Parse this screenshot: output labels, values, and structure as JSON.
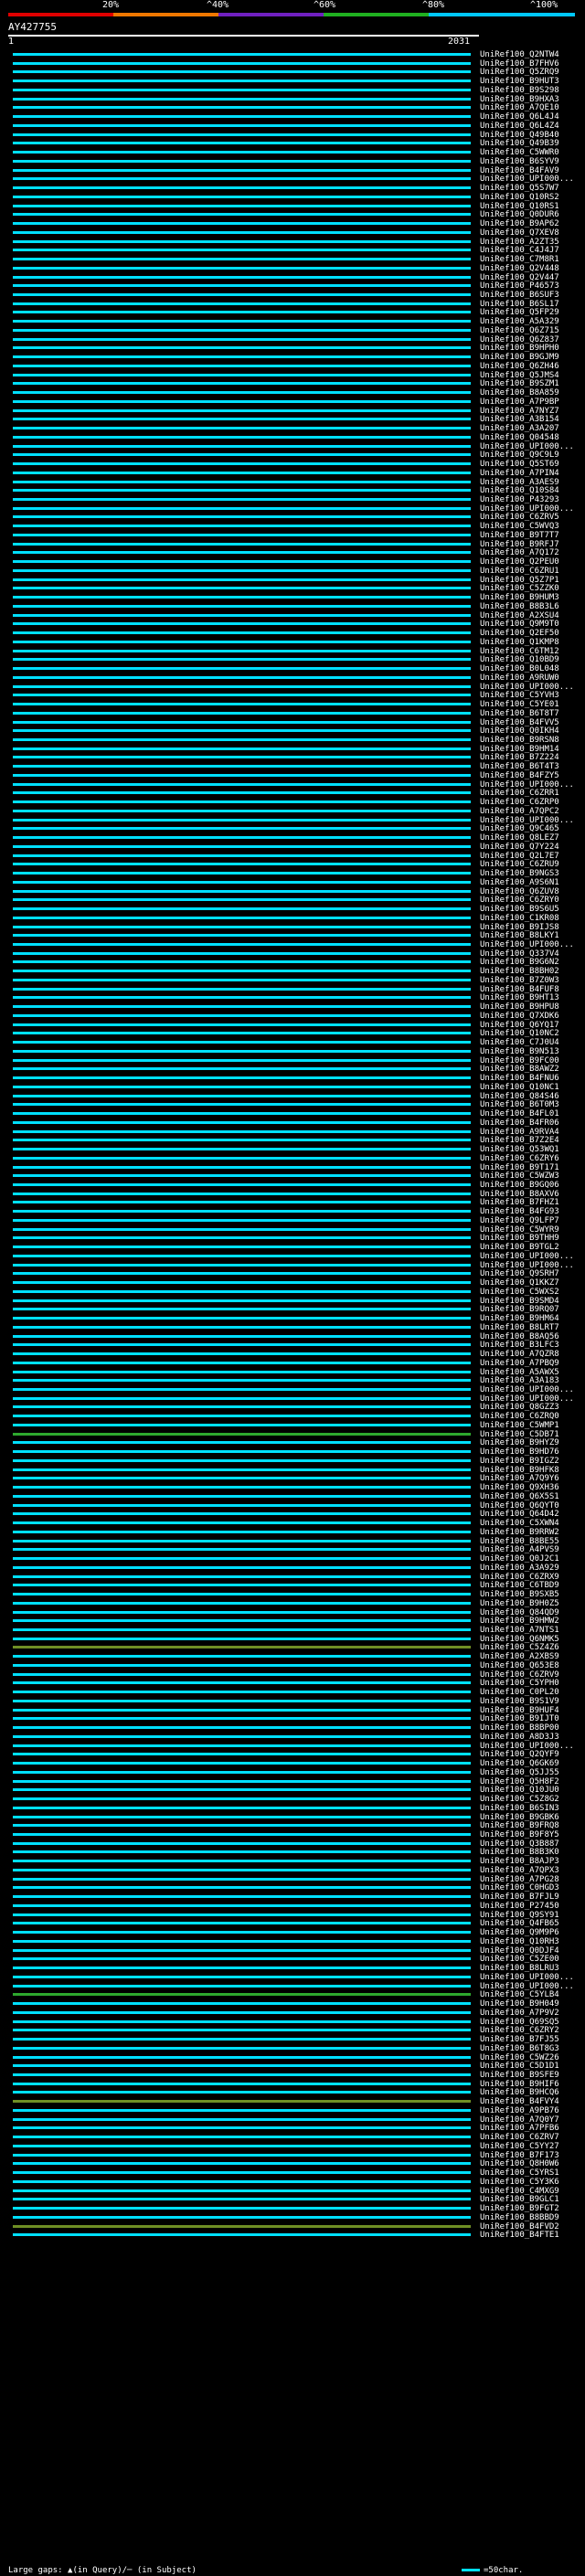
{
  "legend": {
    "colors": [
      "#e00000",
      "#f07800",
      "#7020c0",
      "#20b020",
      "#00c8ff"
    ],
    "ticks": [
      "20%",
      "^40%",
      "^60%",
      "^80%",
      "^100%"
    ]
  },
  "query": {
    "id": "AY427755",
    "start": "1",
    "end": "2031"
  },
  "hits": [
    {
      "label": "UniRef100_Q2NTW4",
      "color": "cyan"
    },
    {
      "label": "UniRef100_B7FHV6",
      "color": "cyan"
    },
    {
      "label": "UniRef100_Q5ZRQ9",
      "color": "cyan"
    },
    {
      "label": "UniRef100_B9HUT3",
      "color": "cyan"
    },
    {
      "label": "UniRef100_B9S298",
      "color": "cyan"
    },
    {
      "label": "UniRef100_B9HXA3",
      "color": "cyan"
    },
    {
      "label": "UniRef100_A7QE10",
      "color": "cyan"
    },
    {
      "label": "UniRef100_Q6L4J4",
      "color": "cyan"
    },
    {
      "label": "UniRef100_Q6L4Z4",
      "color": "cyan"
    },
    {
      "label": "UniRef100_Q49B40",
      "color": "cyan"
    },
    {
      "label": "UniRef100_Q49B39",
      "color": "cyan"
    },
    {
      "label": "UniRef100_C5WWR0",
      "color": "cyan"
    },
    {
      "label": "UniRef100_B6SYV9",
      "color": "cyan"
    },
    {
      "label": "UniRef100_B4FAV9",
      "color": "cyan"
    },
    {
      "label": "UniRef100_UPI000...",
      "color": "cyan"
    },
    {
      "label": "UniRef100_Q5S7W7",
      "color": "cyan"
    },
    {
      "label": "UniRef100_Q10RS2",
      "color": "cyan"
    },
    {
      "label": "UniRef100_Q10RS1",
      "color": "cyan"
    },
    {
      "label": "UniRef100_Q0DUR6",
      "color": "cyan"
    },
    {
      "label": "UniRef100_B9AP62",
      "color": "cyan"
    },
    {
      "label": "UniRef100_Q7XEV8",
      "color": "cyan"
    },
    {
      "label": "UniRef100_A2ZT35",
      "color": "cyan"
    },
    {
      "label": "UniRef100_C4J4J7",
      "color": "cyan"
    },
    {
      "label": "UniRef100_C7M8R1",
      "color": "cyan"
    },
    {
      "label": "UniRef100_Q2V448",
      "color": "cyan"
    },
    {
      "label": "UniRef100_Q2V447",
      "color": "cyan"
    },
    {
      "label": "UniRef100_P46573",
      "color": "cyan"
    },
    {
      "label": "UniRef100_B6SUF3",
      "color": "cyan"
    },
    {
      "label": "UniRef100_B6SL17",
      "color": "cyan"
    },
    {
      "label": "UniRef100_Q5FP29",
      "color": "cyan"
    },
    {
      "label": "UniRef100_A5A329",
      "color": "cyan"
    },
    {
      "label": "UniRef100_Q6Z715",
      "color": "cyan"
    },
    {
      "label": "UniRef100_Q6Z837",
      "color": "cyan"
    },
    {
      "label": "UniRef100_B9HPH0",
      "color": "cyan"
    },
    {
      "label": "UniRef100_B9GJM9",
      "color": "cyan"
    },
    {
      "label": "UniRef100_Q6ZH46",
      "color": "cyan"
    },
    {
      "label": "UniRef100_Q5JMS4",
      "color": "cyan"
    },
    {
      "label": "UniRef100_B9SZM1",
      "color": "cyan"
    },
    {
      "label": "UniRef100_B8A859",
      "color": "cyan"
    },
    {
      "label": "UniRef100_A7P9BP",
      "color": "cyan"
    },
    {
      "label": "UniRef100_A7NYZ7",
      "color": "cyan"
    },
    {
      "label": "UniRef100_A3B154",
      "color": "cyan"
    },
    {
      "label": "UniRef100_A3A207",
      "color": "cyan"
    },
    {
      "label": "UniRef100_Q04548",
      "color": "cyan"
    },
    {
      "label": "UniRef100_UPI000...",
      "color": "cyan"
    },
    {
      "label": "UniRef100_Q9C9L9",
      "color": "cyan"
    },
    {
      "label": "UniRef100_Q5ST69",
      "color": "cyan"
    },
    {
      "label": "UniRef100_A7PIN4",
      "color": "cyan"
    },
    {
      "label": "UniRef100_A3AES9",
      "color": "cyan"
    },
    {
      "label": "UniRef100_Q10S84",
      "color": "cyan"
    },
    {
      "label": "UniRef100_P43293",
      "color": "cyan"
    },
    {
      "label": "UniRef100_UPI000...",
      "color": "cyan"
    },
    {
      "label": "UniRef100_C6ZRV5",
      "color": "cyan"
    },
    {
      "label": "UniRef100_C5WVQ3",
      "color": "cyan"
    },
    {
      "label": "UniRef100_B9T7T7",
      "color": "cyan"
    },
    {
      "label": "UniRef100_B9RFJ7",
      "color": "cyan"
    },
    {
      "label": "UniRef100_A7Q172",
      "color": "cyan"
    },
    {
      "label": "UniRef100_Q2PEU0",
      "color": "cyan"
    },
    {
      "label": "UniRef100_C6ZRU1",
      "color": "cyan"
    },
    {
      "label": "UniRef100_Q5Z7P1",
      "color": "cyan"
    },
    {
      "label": "UniRef100_C5ZZK0",
      "color": "cyan"
    },
    {
      "label": "UniRef100_B9HUM3",
      "color": "cyan"
    },
    {
      "label": "UniRef100_B8B3L6",
      "color": "cyan"
    },
    {
      "label": "UniRef100_A2XSU4",
      "color": "cyan"
    },
    {
      "label": "UniRef100_Q9M9T0",
      "color": "cyan"
    },
    {
      "label": "UniRef100_Q2EF50",
      "color": "cyan"
    },
    {
      "label": "UniRef100_Q1KMP8",
      "color": "cyan"
    },
    {
      "label": "UniRef100_C6TM12",
      "color": "cyan"
    },
    {
      "label": "UniRef100_Q10BD9",
      "color": "cyan"
    },
    {
      "label": "UniRef100_B0L048",
      "color": "cyan"
    },
    {
      "label": "UniRef100_A9RUW0",
      "color": "cyan"
    },
    {
      "label": "UniRef100_UPI000...",
      "color": "cyan"
    },
    {
      "label": "UniRef100_C5YVH3",
      "color": "cyan"
    },
    {
      "label": "UniRef100_C5YE01",
      "color": "cyan"
    },
    {
      "label": "UniRef100_B6T8T7",
      "color": "cyan"
    },
    {
      "label": "UniRef100_B4FVV5",
      "color": "cyan"
    },
    {
      "label": "UniRef100_Q0IKH4",
      "color": "cyan"
    },
    {
      "label": "UniRef100_B9RSN8",
      "color": "cyan"
    },
    {
      "label": "UniRef100_B9HM14",
      "color": "cyan"
    },
    {
      "label": "UniRef100_B7Z224",
      "color": "cyan"
    },
    {
      "label": "UniRef100_B6T4T3",
      "color": "cyan"
    },
    {
      "label": "UniRef100_B4FZY5",
      "color": "cyan"
    },
    {
      "label": "UniRef100_UPI000...",
      "color": "cyan"
    },
    {
      "label": "UniRef100_C6ZRR1",
      "color": "cyan"
    },
    {
      "label": "UniRef100_C6ZRP0",
      "color": "cyan"
    },
    {
      "label": "UniRef100_A7QPC2",
      "color": "cyan"
    },
    {
      "label": "UniRef100_UPI000...",
      "color": "cyan"
    },
    {
      "label": "UniRef100_Q9C465",
      "color": "cyan"
    },
    {
      "label": "UniRef100_Q8LEZ7",
      "color": "cyan"
    },
    {
      "label": "UniRef100_Q7Y224",
      "color": "cyan"
    },
    {
      "label": "UniRef100_Q2L7E7",
      "color": "cyan"
    },
    {
      "label": "UniRef100_C6ZRU9",
      "color": "cyan"
    },
    {
      "label": "UniRef100_B9NGS3",
      "color": "cyan"
    },
    {
      "label": "UniRef100_A9S6N1",
      "color": "cyan"
    },
    {
      "label": "UniRef100_Q6ZUV8",
      "color": "cyan"
    },
    {
      "label": "UniRef100_C6ZRY0",
      "color": "cyan"
    },
    {
      "label": "UniRef100_B9S6U5",
      "color": "cyan"
    },
    {
      "label": "UniRef100_C1KR08",
      "color": "cyan"
    },
    {
      "label": "UniRef100_B9IJS8",
      "color": "cyan"
    },
    {
      "label": "UniRef100_B8LKY1",
      "color": "cyan"
    },
    {
      "label": "UniRef100_UPI000...",
      "color": "cyan"
    },
    {
      "label": "UniRef100_Q337V4",
      "color": "cyan"
    },
    {
      "label": "UniRef100_B9G6N2",
      "color": "cyan"
    },
    {
      "label": "UniRef100_B8BH02",
      "color": "cyan"
    },
    {
      "label": "UniRef100_B7Z0W3",
      "color": "cyan"
    },
    {
      "label": "UniRef100_B4FUF8",
      "color": "cyan"
    },
    {
      "label": "UniRef100_B9HT13",
      "color": "cyan"
    },
    {
      "label": "UniRef100_B9HPU8",
      "color": "cyan"
    },
    {
      "label": "UniRef100_Q7XDK6",
      "color": "cyan"
    },
    {
      "label": "UniRef100_Q6YQ17",
      "color": "cyan"
    },
    {
      "label": "UniRef100_Q10NC2",
      "color": "cyan"
    },
    {
      "label": "UniRef100_C7J0U4",
      "color": "cyan"
    },
    {
      "label": "UniRef100_B9N513",
      "color": "cyan"
    },
    {
      "label": "UniRef100_B9FC00",
      "color": "cyan"
    },
    {
      "label": "UniRef100_B8AWZ2",
      "color": "cyan"
    },
    {
      "label": "UniRef100_B4FNU6",
      "color": "cyan"
    },
    {
      "label": "UniRef100_Q10NC1",
      "color": "cyan"
    },
    {
      "label": "UniRef100_Q84S46",
      "color": "cyan"
    },
    {
      "label": "UniRef100_B6T0M3",
      "color": "cyan"
    },
    {
      "label": "UniRef100_B4FL01",
      "color": "cyan"
    },
    {
      "label": "UniRef100_B4FR06",
      "color": "cyan"
    },
    {
      "label": "UniRef100_A9RVA4",
      "color": "cyan"
    },
    {
      "label": "UniRef100_B7Z2E4",
      "color": "cyan"
    },
    {
      "label": "UniRef100_Q53WQ1",
      "color": "cyan"
    },
    {
      "label": "UniRef100_C6ZRY6",
      "color": "cyan"
    },
    {
      "label": "UniRef100_B9T171",
      "color": "cyan"
    },
    {
      "label": "UniRef100_C5WZW3",
      "color": "cyan"
    },
    {
      "label": "UniRef100_B9GQ06",
      "color": "cyan"
    },
    {
      "label": "UniRef100_B8AXV6",
      "color": "cyan"
    },
    {
      "label": "UniRef100_B7FHZ1",
      "color": "cyan"
    },
    {
      "label": "UniRef100_B4FG93",
      "color": "cyan"
    },
    {
      "label": "UniRef100_Q9LFP7",
      "color": "cyan"
    },
    {
      "label": "UniRef100_C5WYR9",
      "color": "cyan"
    },
    {
      "label": "UniRef100_B9THH9",
      "color": "cyan"
    },
    {
      "label": "UniRef100_B9TGL2",
      "color": "cyan"
    },
    {
      "label": "UniRef100_UPI000...",
      "color": "cyan"
    },
    {
      "label": "UniRef100_UPI000...",
      "color": "cyan"
    },
    {
      "label": "UniRef100_Q9SRH7",
      "color": "cyan"
    },
    {
      "label": "UniRef100_Q1KKZ7",
      "color": "cyan"
    },
    {
      "label": "UniRef100_C5WXS2",
      "color": "cyan"
    },
    {
      "label": "UniRef100_B9SMD4",
      "color": "cyan"
    },
    {
      "label": "UniRef100_B9RQ07",
      "color": "cyan"
    },
    {
      "label": "UniRef100_B9HM64",
      "color": "cyan"
    },
    {
      "label": "UniRef100_B8LRT7",
      "color": "cyan"
    },
    {
      "label": "UniRef100_B8AQ56",
      "color": "cyan"
    },
    {
      "label": "UniRef100_B3LFC3",
      "color": "cyan"
    },
    {
      "label": "UniRef100_A7QZR8",
      "color": "cyan"
    },
    {
      "label": "UniRef100_A7PBQ9",
      "color": "cyan"
    },
    {
      "label": "UniRef100_A5AWX5",
      "color": "cyan"
    },
    {
      "label": "UniRef100_A3A183",
      "color": "cyan"
    },
    {
      "label": "UniRef100_UPI000...",
      "color": "cyan"
    },
    {
      "label": "UniRef100_UPI000...",
      "color": "cyan"
    },
    {
      "label": "UniRef100_Q8GZZ3",
      "color": "cyan"
    },
    {
      "label": "UniRef100_C6ZRQ0",
      "color": "cyan"
    },
    {
      "label": "UniRef100_C5WMP1",
      "color": "cyan"
    },
    {
      "label": "UniRef100_C5DB71",
      "color": "green"
    },
    {
      "label": "UniRef100_B9HYZ9",
      "color": "cyan"
    },
    {
      "label": "UniRef100_B9HD76",
      "color": "cyan"
    },
    {
      "label": "UniRef100_B9IGZ2",
      "color": "cyan"
    },
    {
      "label": "UniRef100_B9HFK8",
      "color": "cyan"
    },
    {
      "label": "UniRef100_A7Q9Y6",
      "color": "cyan"
    },
    {
      "label": "UniRef100_Q9XH36",
      "color": "cyan"
    },
    {
      "label": "UniRef100_Q6X5S1",
      "color": "cyan"
    },
    {
      "label": "UniRef100_Q6QYT0",
      "color": "cyan"
    },
    {
      "label": "UniRef100_Q64D42",
      "color": "cyan"
    },
    {
      "label": "UniRef100_C5XWN4",
      "color": "cyan"
    },
    {
      "label": "UniRef100_B9RRW2",
      "color": "cyan"
    },
    {
      "label": "UniRef100_B8BE55",
      "color": "cyan"
    },
    {
      "label": "UniRef100_A4PVS9",
      "color": "cyan"
    },
    {
      "label": "UniRef100_Q0J2C1",
      "color": "cyan"
    },
    {
      "label": "UniRef100_A3A929",
      "color": "cyan"
    },
    {
      "label": "UniRef100_C6ZRX9",
      "color": "cyan"
    },
    {
      "label": "UniRef100_C6TBD9",
      "color": "cyan"
    },
    {
      "label": "UniRef100_B9SXB5",
      "color": "cyan"
    },
    {
      "label": "UniRef100_B9H0Z5",
      "color": "cyan"
    },
    {
      "label": "UniRef100_Q84QD9",
      "color": "cyan"
    },
    {
      "label": "UniRef100_B9HMW2",
      "color": "cyan"
    },
    {
      "label": "UniRef100_A7NTS1",
      "color": "cyan"
    },
    {
      "label": "UniRef100_Q6NMK5",
      "color": "cyan"
    },
    {
      "label": "UniRef100_C5Z4Z6",
      "color": "olive"
    },
    {
      "label": "UniRef100_A2XBS9",
      "color": "cyan"
    },
    {
      "label": "UniRef100_Q653E8",
      "color": "cyan"
    },
    {
      "label": "UniRef100_C6ZRV9",
      "color": "cyan"
    },
    {
      "label": "UniRef100_C5YPH0",
      "color": "cyan"
    },
    {
      "label": "UniRef100_C0PL20",
      "color": "cyan"
    },
    {
      "label": "UniRef100_B9S1V9",
      "color": "cyan"
    },
    {
      "label": "UniRef100_B9HUF4",
      "color": "cyan"
    },
    {
      "label": "UniRef100_B9IJT0",
      "color": "cyan"
    },
    {
      "label": "UniRef100_B8BP00",
      "color": "cyan"
    },
    {
      "label": "UniRef100_A8D3J3",
      "color": "cyan"
    },
    {
      "label": "UniRef100_UPI000...",
      "color": "cyan"
    },
    {
      "label": "UniRef100_Q2QYF9",
      "color": "cyan"
    },
    {
      "label": "UniRef100_Q6GK69",
      "color": "cyan"
    },
    {
      "label": "UniRef100_Q5JJ55",
      "color": "cyan"
    },
    {
      "label": "UniRef100_Q5H8F2",
      "color": "cyan"
    },
    {
      "label": "UniRef100_Q10JU0",
      "color": "cyan"
    },
    {
      "label": "UniRef100_C5Z8G2",
      "color": "cyan"
    },
    {
      "label": "UniRef100_B6SIN3",
      "color": "cyan"
    },
    {
      "label": "UniRef100_B9GBK6",
      "color": "cyan"
    },
    {
      "label": "UniRef100_B9FRQ8",
      "color": "cyan"
    },
    {
      "label": "UniRef100_B9F8Y5",
      "color": "cyan"
    },
    {
      "label": "UniRef100_Q3B887",
      "color": "cyan"
    },
    {
      "label": "UniRef100_B8B3K0",
      "color": "cyan"
    },
    {
      "label": "UniRef100_B8AJP3",
      "color": "cyan"
    },
    {
      "label": "UniRef100_A7QPX3",
      "color": "cyan"
    },
    {
      "label": "UniRef100_A7PG28",
      "color": "cyan"
    },
    {
      "label": "UniRef100_C0HGD3",
      "color": "cyan"
    },
    {
      "label": "UniRef100_B7FJL9",
      "color": "cyan"
    },
    {
      "label": "UniRef100_P27450",
      "color": "cyan"
    },
    {
      "label": "UniRef100_Q9SY91",
      "color": "cyan"
    },
    {
      "label": "UniRef100_Q4FB65",
      "color": "cyan"
    },
    {
      "label": "UniRef100_Q9M9P6",
      "color": "cyan"
    },
    {
      "label": "UniRef100_Q10RH3",
      "color": "cyan"
    },
    {
      "label": "UniRef100_Q0DJF4",
      "color": "cyan"
    },
    {
      "label": "UniRef100_C5ZE00",
      "color": "cyan"
    },
    {
      "label": "UniRef100_B8LRU3",
      "color": "cyan"
    },
    {
      "label": "UniRef100_UPI000...",
      "color": "cyan"
    },
    {
      "label": "UniRef100_UPI000...",
      "color": "cyan"
    },
    {
      "label": "UniRef100_C5YLB4",
      "color": "green"
    },
    {
      "label": "UniRef100_B9H049",
      "color": "cyan"
    },
    {
      "label": "UniRef100_A7P9V2",
      "color": "cyan"
    },
    {
      "label": "UniRef100_Q69SQ5",
      "color": "cyan"
    },
    {
      "label": "UniRef100_C6ZRY2",
      "color": "cyan"
    },
    {
      "label": "UniRef100_B7FJ55",
      "color": "cyan"
    },
    {
      "label": "UniRef100_B6T8G3",
      "color": "cyan"
    },
    {
      "label": "UniRef100_C5WZ26",
      "color": "cyan"
    },
    {
      "label": "UniRef100_C5D1D1",
      "color": "cyan"
    },
    {
      "label": "UniRef100_B9SFE9",
      "color": "cyan"
    },
    {
      "label": "UniRef100_B9HIF6",
      "color": "cyan"
    },
    {
      "label": "UniRef100_B9HCQ6",
      "color": "cyan"
    },
    {
      "label": "UniRef100_B4FVY4",
      "color": "olive"
    },
    {
      "label": "UniRef100_A9PB76",
      "color": "cyan"
    },
    {
      "label": "UniRef100_A7Q0Y7",
      "color": "cyan"
    },
    {
      "label": "UniRef100_A7PFB6",
      "color": "cyan"
    },
    {
      "label": "UniRef100_C6ZRV7",
      "color": "cyan"
    },
    {
      "label": "UniRef100_C5YY27",
      "color": "cyan"
    },
    {
      "label": "UniRef100_B7F173",
      "color": "cyan"
    },
    {
      "label": "UniRef100_Q8H0W6",
      "color": "cyan"
    },
    {
      "label": "UniRef100_C5YRS1",
      "color": "cyan"
    },
    {
      "label": "UniRef100_C5Y3K6",
      "color": "cyan"
    },
    {
      "label": "UniRef100_C4MXG9",
      "color": "cyan"
    },
    {
      "label": "UniRef100_B9GLC1",
      "color": "cyan"
    },
    {
      "label": "UniRef100_B9FGT2",
      "color": "cyan"
    },
    {
      "label": "UniRef100_B8BBD9",
      "color": "cyan"
    },
    {
      "label": "UniRef100_B4FVD2",
      "color": "olive"
    },
    {
      "label": "UniRef100_B4FTE1",
      "color": "cyan"
    }
  ],
  "footer": {
    "large_gaps_label": "Large gaps: ▲(in Query)/─ (in Subject)",
    "scale_label": "=50char."
  }
}
